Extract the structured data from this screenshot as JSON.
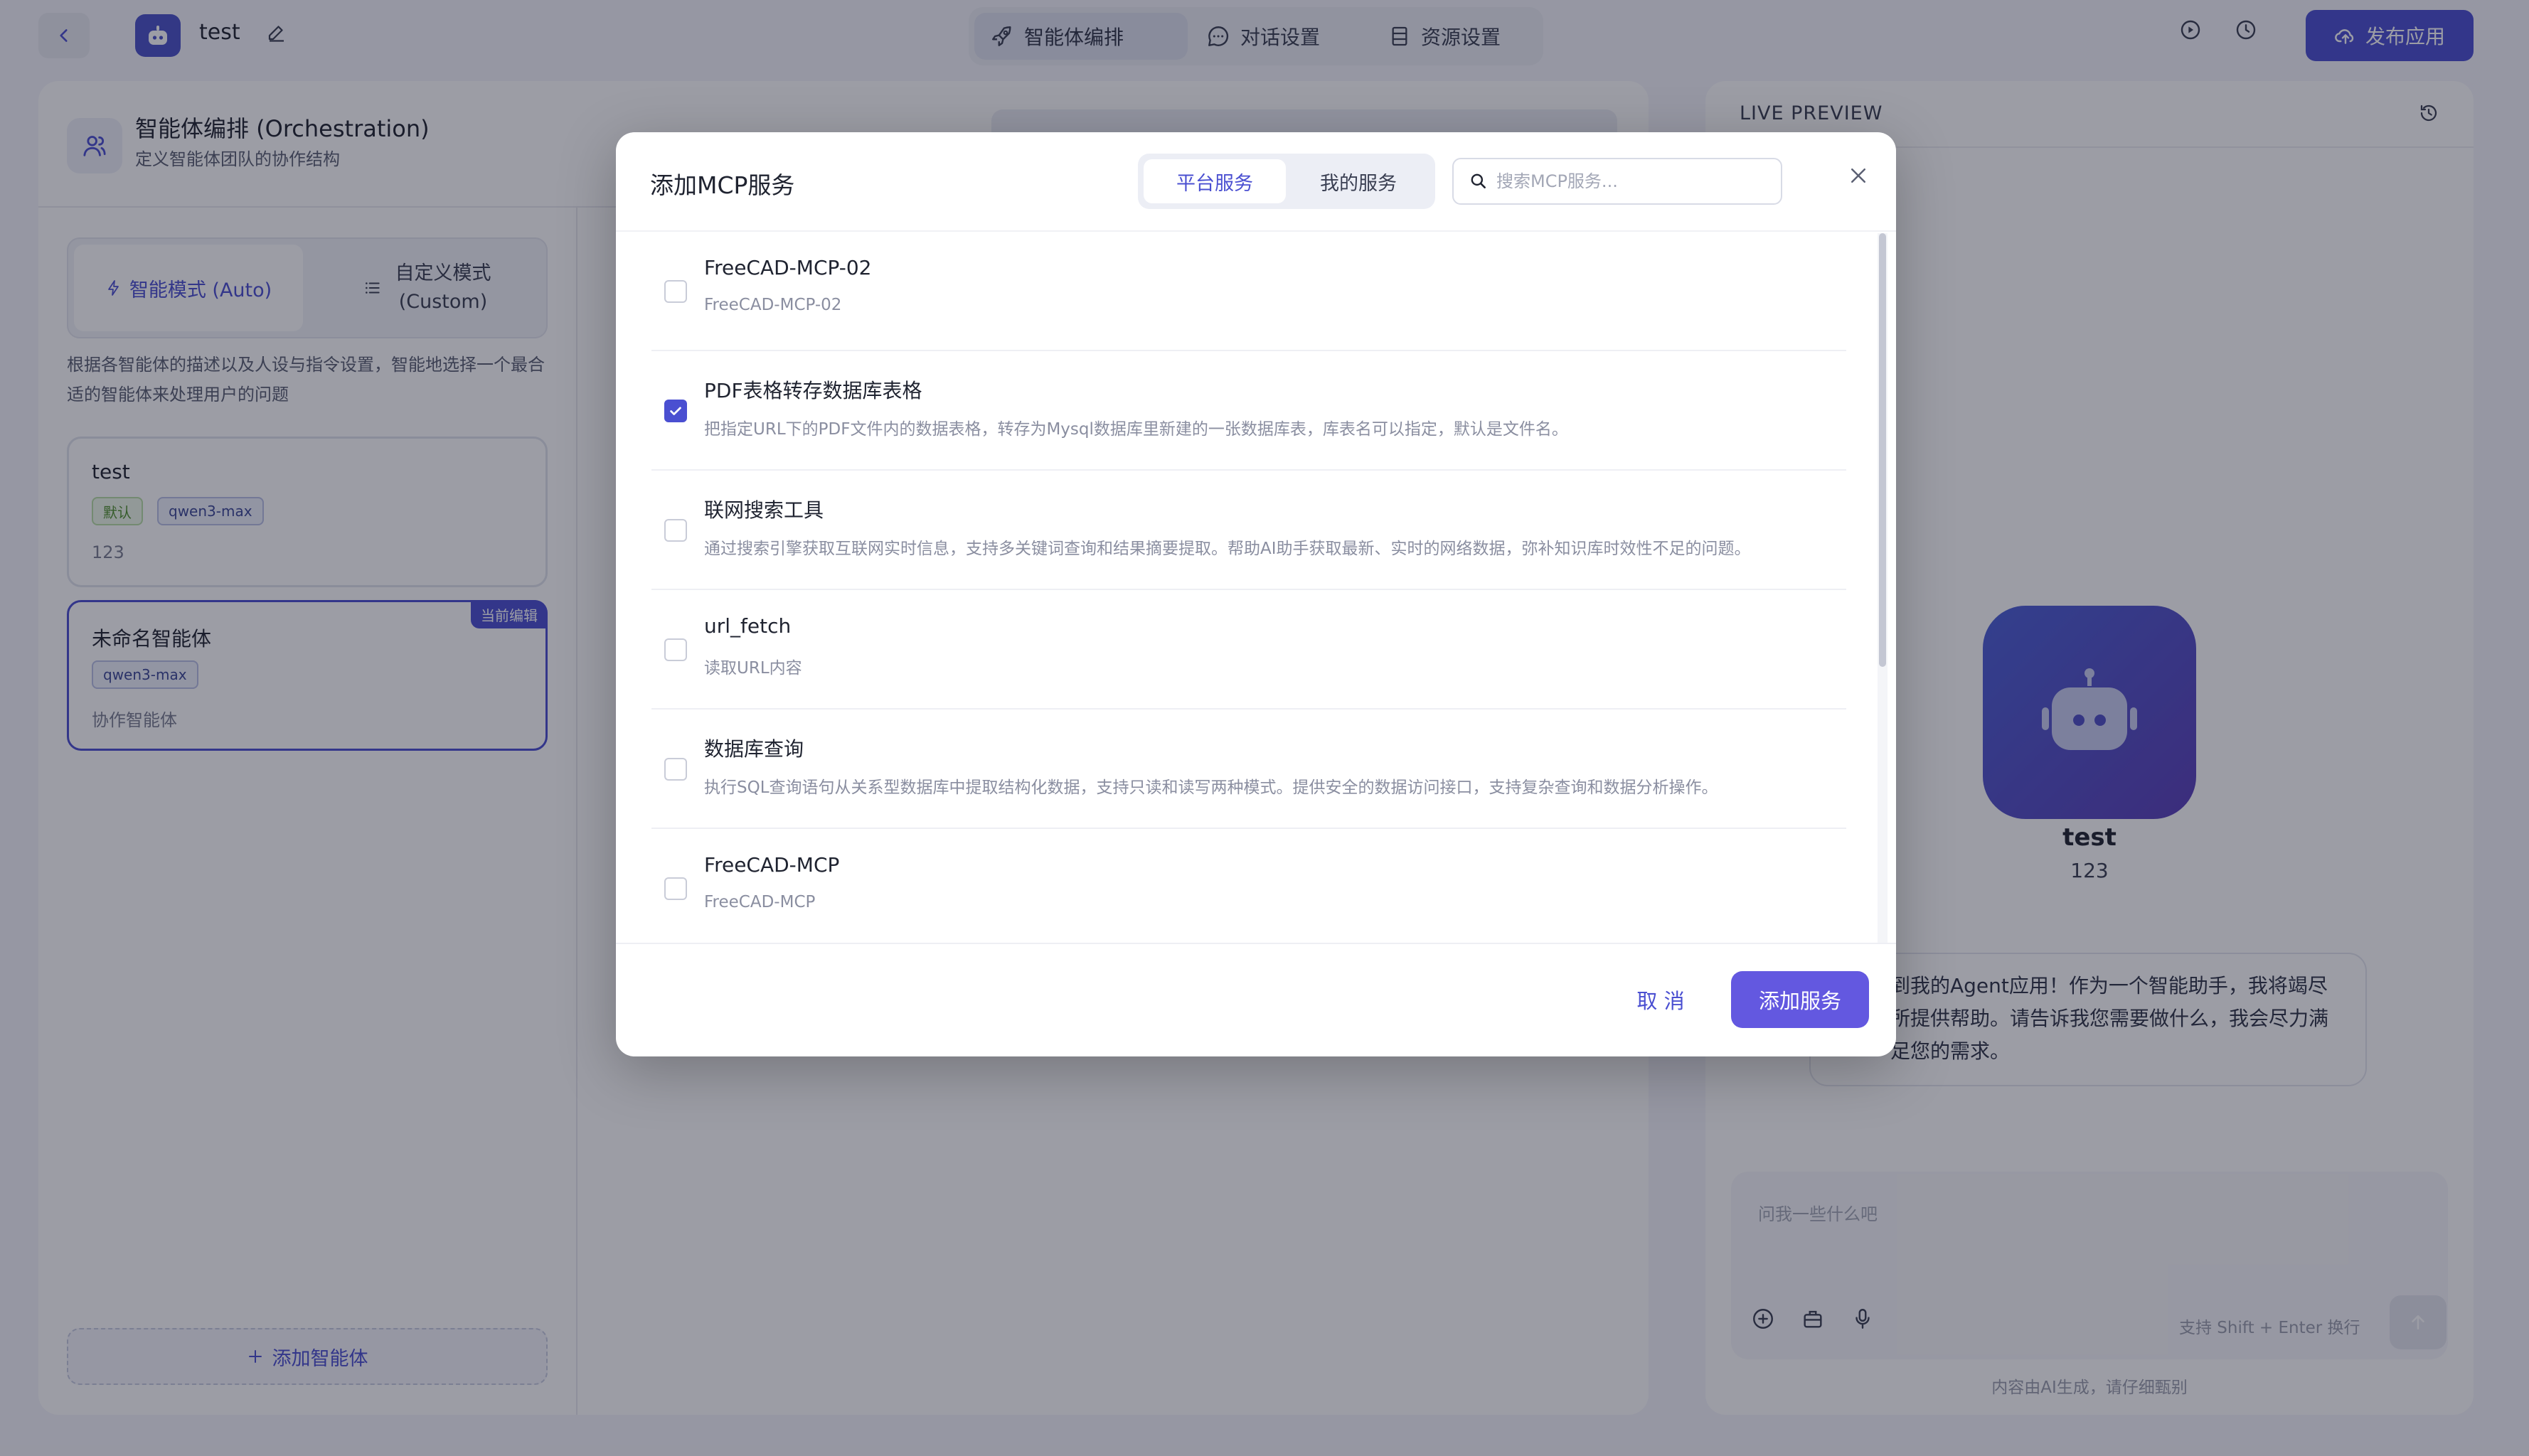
{
  "header": {
    "app_name": "test",
    "tabs": [
      {
        "label": "智能体编排",
        "icon": "rocket-icon"
      },
      {
        "label": "对话设置",
        "icon": "chat-icon"
      },
      {
        "label": "资源设置",
        "icon": "database-icon"
      }
    ],
    "publish_label": "发布应用"
  },
  "orchestration": {
    "title": "智能体编排 (Orchestration)",
    "subtitle": "定义智能体团队的协作结构",
    "mode_auto": "智能模式 (Auto)",
    "mode_custom_line1": "自定义模式",
    "mode_custom_line2": "(Custom)",
    "mode_description": "根据各智能体的描述以及人设与指令设置，智能地选择一个最合适的智能体来处理用户的问题",
    "agents": [
      {
        "name": "test",
        "tag_default": "默认",
        "model": "qwen3-max",
        "description": "123"
      },
      {
        "name": "未命名智能体",
        "model": "qwen3-max",
        "description": "协作智能体",
        "badge": "当前编辑"
      }
    ],
    "add_agent_label": "添加智能体"
  },
  "preview": {
    "label": "LIVE PREVIEW",
    "bot_name": "test",
    "bot_desc": "123",
    "welcome_message": "到我的Agent应用！作为一个智能助手，我将竭尽所提供帮助。请告诉我您需要做什么，我会尽力满足您的需求。",
    "input_placeholder": "问我一些什么吧",
    "input_hint": "支持 Shift + Enter 换行",
    "footnote": "内容由AI生成，请仔细甄别"
  },
  "modal": {
    "title": "添加MCP服务",
    "tab_platform": "平台服务",
    "tab_mine": "我的服务",
    "search_placeholder": "搜索MCP服务...",
    "cancel_label": "取 消",
    "confirm_label": "添加服务",
    "services": [
      {
        "name": "FreeCAD-MCP-02",
        "description": "FreeCAD-MCP-02",
        "checked": false
      },
      {
        "name": "PDF表格转存数据库表格",
        "description": "把指定URL下的PDF文件内的数据表格，转存为Mysql数据库里新建的一张数据库表，库表名可以指定，默认是文件名。",
        "checked": true
      },
      {
        "name": "联网搜索工具",
        "description": "通过搜索引擎获取互联网实时信息，支持多关键词查询和结果摘要提取。帮助AI助手获取最新、实时的网络数据，弥补知识库时效性不足的问题。",
        "checked": false
      },
      {
        "name": "url_fetch",
        "description": "读取URL内容",
        "checked": false
      },
      {
        "name": "数据库查询",
        "description": "执行SQL查询语句从关系型数据库中提取结构化数据，支持只读和读写两种模式。提供安全的数据访问接口，支持复杂查询和数据分析操作。",
        "checked": false
      },
      {
        "name": "FreeCAD-MCP",
        "description": "FreeCAD-MCP",
        "checked": false
      }
    ]
  },
  "colors": {
    "accent": "#4a4fd1",
    "primary_button": "#6358e0",
    "overlay": "rgba(20,22,40,0.42)"
  }
}
